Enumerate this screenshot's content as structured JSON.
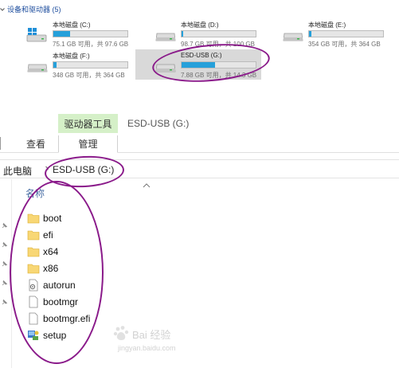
{
  "drives_section": {
    "title": "设备和驱动器 (5)"
  },
  "drives": [
    {
      "name": "本地磁盘 (C:)",
      "space": "75.1 GB 可用，共 97.6 GB",
      "used_fraction": 0.23,
      "icon": "windows-drive-icon"
    },
    {
      "name": "本地磁盘 (D:)",
      "space": "98.7 GB 可用，共 100 GB",
      "used_fraction": 0.02,
      "icon": "hard-drive-icon"
    },
    {
      "name": "本地磁盘 (E:)",
      "space": "354 GB 可用，共 364 GB",
      "used_fraction": 0.03,
      "icon": "hard-drive-icon"
    },
    {
      "name": "本地磁盘 (F:)",
      "space": "348 GB 可用，共 364 GB",
      "used_fraction": 0.04,
      "icon": "hard-drive-icon"
    },
    {
      "name": "ESD-USB (G:)",
      "space": "7.88 GB 可用，共 14.3 GB",
      "used_fraction": 0.45,
      "icon": "usb-drive-icon"
    }
  ],
  "ribbon": {
    "tool_tab": "驱动器工具",
    "window_title": "ESD-USB (G:)",
    "tabs": {
      "view": "查看",
      "manage": "管理"
    }
  },
  "address": {
    "root": "此电脑",
    "current": "ESD-USB (G:)"
  },
  "file_list": {
    "column_name": "名称",
    "items": [
      {
        "name": "boot",
        "icon": "folder-icon"
      },
      {
        "name": "efi",
        "icon": "folder-icon"
      },
      {
        "name": "x64",
        "icon": "folder-icon"
      },
      {
        "name": "x86",
        "icon": "folder-icon"
      },
      {
        "name": "autorun",
        "icon": "settings-file-icon"
      },
      {
        "name": "bootmgr",
        "icon": "file-icon"
      },
      {
        "name": "bootmgr.efi",
        "icon": "file-icon"
      },
      {
        "name": "setup",
        "icon": "setup-icon"
      }
    ]
  },
  "colors": {
    "accent": "#26a0da",
    "annotation": "#8a1a8a",
    "tool_tab": "#d5f0c8",
    "folder": "#f8d775"
  },
  "watermark": {
    "brand": "Bai 经验",
    "url": "jingyan.baidu.com"
  }
}
